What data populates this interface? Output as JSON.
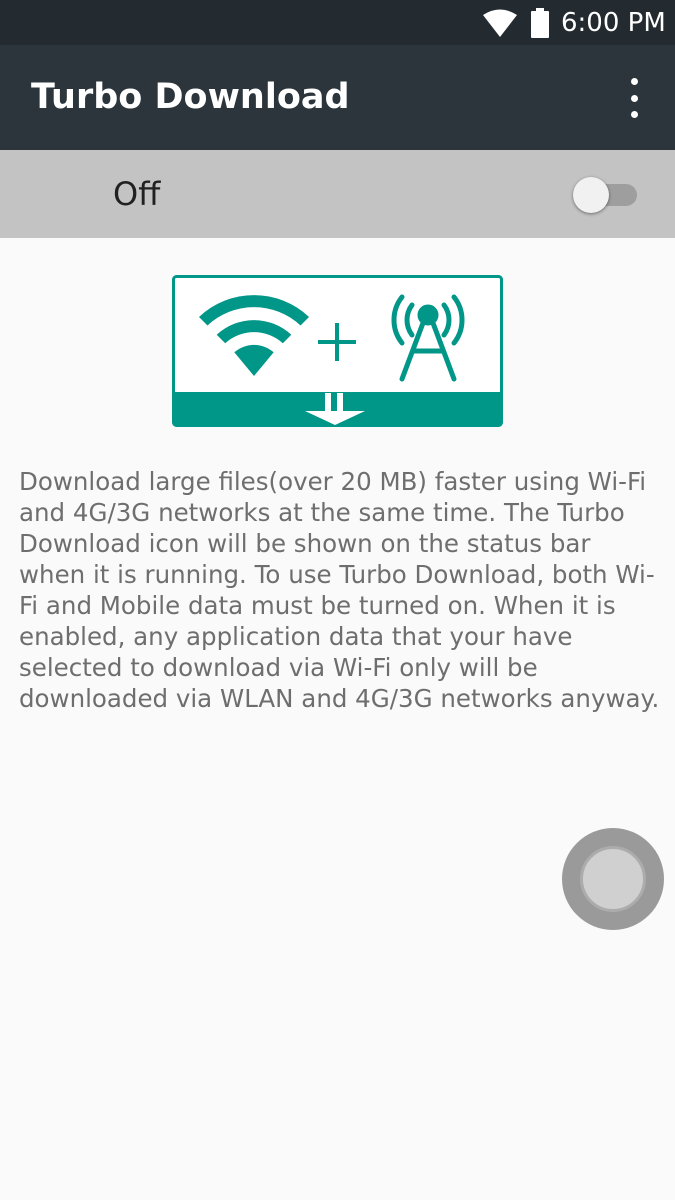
{
  "status_bar": {
    "time": "6:00 PM",
    "icons": [
      "wifi-icon",
      "battery-icon"
    ]
  },
  "app_bar": {
    "title": "Turbo Download",
    "menu_icon": "more-vert-icon"
  },
  "switch_bar": {
    "label": "Off",
    "enabled": false
  },
  "illustration": {
    "icons": [
      "wifi-icon",
      "plus-icon",
      "cell-tower-icon",
      "download-arrow-icon"
    ],
    "accent_color": "#009688"
  },
  "description": "Download large files(over 20 MB) faster using Wi-Fi and 4G/3G networks at the same time. The Turbo Download icon will be shown on the status bar when it is running. To use Turbo Download, both Wi-Fi and Mobile data must be turned on. When it is enabled, any application data that your have selected to download via Wi-Fi only will be downloaded via WLAN and 4G/3G networks anyway.",
  "colors": {
    "status_bar": "#232b30",
    "app_bar": "#2b353b",
    "switch_bar": "#c3c3c3",
    "background": "#fafafa",
    "accent": "#009688"
  }
}
